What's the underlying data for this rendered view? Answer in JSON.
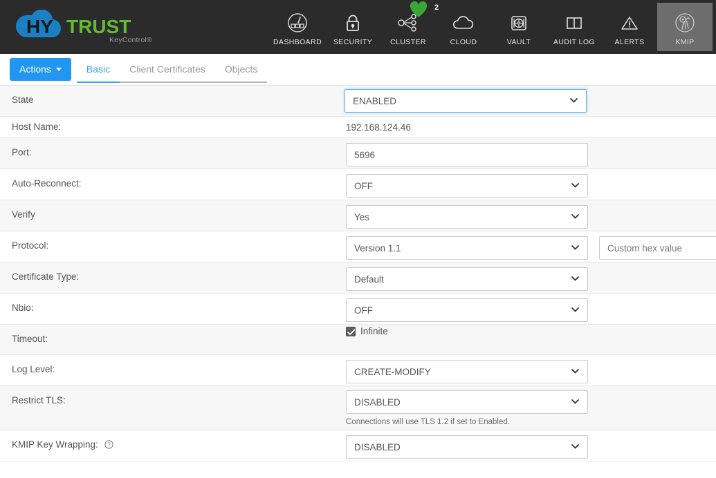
{
  "brand": {
    "name_hy": "HY",
    "name_trust": "TRUST",
    "subtitle": "KeyControl®"
  },
  "topnav": {
    "items": [
      {
        "label": "DASHBOARD",
        "icon": "dashboard-gauge-icon",
        "active": false,
        "badge": null
      },
      {
        "label": "SECURITY",
        "icon": "padlock-icon",
        "active": false,
        "badge": null
      },
      {
        "label": "CLUSTER",
        "icon": "cluster-nodes-icon",
        "active": false,
        "badge": "2"
      },
      {
        "label": "CLOUD",
        "icon": "cloud-icon",
        "active": false,
        "badge": null
      },
      {
        "label": "VAULT",
        "icon": "vault-safe-icon",
        "active": false,
        "badge": null
      },
      {
        "label": "AUDIT LOG",
        "icon": "open-book-icon",
        "active": false,
        "badge": null
      },
      {
        "label": "ALERTS",
        "icon": "warning-triangle-icon",
        "active": false,
        "badge": null
      },
      {
        "label": "KMIP",
        "icon": "keys-circle-icon",
        "active": true,
        "badge": null
      }
    ],
    "badge_color": "#3aa635",
    "bar_color": "#2b2b2b",
    "active_color": "#6d6d6d"
  },
  "toolbar": {
    "actions_label": "Actions",
    "accent_color": "#2196f3",
    "tabs": [
      {
        "label": "Basic",
        "active": true
      },
      {
        "label": "Client Certificates",
        "active": false
      },
      {
        "label": "Objects",
        "active": false
      }
    ]
  },
  "form": {
    "rows": [
      {
        "label": "State",
        "type": "select",
        "value": "ENABLED",
        "focused": true
      },
      {
        "label": "Host Name:",
        "type": "text",
        "value": "192.168.124.46"
      },
      {
        "label": "Port:",
        "type": "input",
        "value": "5696"
      },
      {
        "label": "Auto-Reconnect:",
        "type": "select",
        "value": "OFF"
      },
      {
        "label": "Verify",
        "type": "select",
        "value": "Yes"
      },
      {
        "label": "Protocol:",
        "type": "select",
        "value": "Version 1.1",
        "extra_placeholder": "Custom hex value"
      },
      {
        "label": "Certificate Type:",
        "type": "select",
        "value": "Default"
      },
      {
        "label": "Nbio:",
        "type": "select",
        "value": "OFF"
      },
      {
        "label": "Timeout:",
        "type": "checkbox",
        "value": "Infinite",
        "checked": true
      },
      {
        "label": "Log Level:",
        "type": "select",
        "value": "CREATE-MODIFY"
      },
      {
        "label": "Restrict TLS:",
        "type": "select",
        "value": "DISABLED",
        "hint": "Connections will use TLS 1.2 if set to Enabled."
      },
      {
        "label": "KMIP Key Wrapping:",
        "type": "select",
        "value": "DISABLED",
        "help": true
      }
    ]
  }
}
